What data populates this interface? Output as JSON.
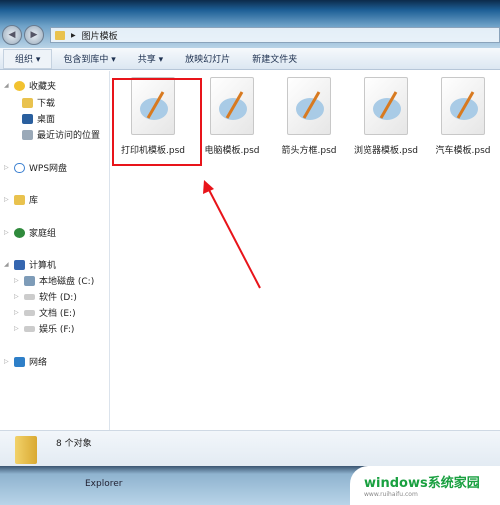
{
  "address": {
    "path": "图片模板"
  },
  "toolbar": {
    "organize": "组织 ▾",
    "include": "包含到库中 ▾",
    "share": "共享 ▾",
    "slideshow": "放映幻灯片",
    "newfolder": "新建文件夹"
  },
  "sidebar": {
    "items": [
      {
        "label": "收藏夹"
      },
      {
        "label": "下载"
      },
      {
        "label": "桌面"
      },
      {
        "label": "最近访问的位置"
      },
      {
        "label": "WPS网盘"
      },
      {
        "label": "库"
      },
      {
        "label": "家庭组"
      },
      {
        "label": "计算机"
      },
      {
        "label": "本地磁盘 (C:)"
      },
      {
        "label": "软件 (D:)"
      },
      {
        "label": "文档 (E:)"
      },
      {
        "label": "娱乐 (F:)"
      },
      {
        "label": "网络"
      }
    ]
  },
  "files": [
    {
      "name": "打印机模板.psd"
    },
    {
      "name": "电脑模板.psd"
    },
    {
      "name": "箭头方框.psd"
    },
    {
      "name": "浏览器模板.psd"
    },
    {
      "name": "汽车模板.psd"
    }
  ],
  "status": {
    "count": "8 个对象"
  },
  "taskbar": {
    "label": "Explorer"
  },
  "watermark": {
    "brand": "windows系统家园",
    "url": "www.ruihaifu.com"
  },
  "colors": {
    "highlight": "#e8141a"
  }
}
